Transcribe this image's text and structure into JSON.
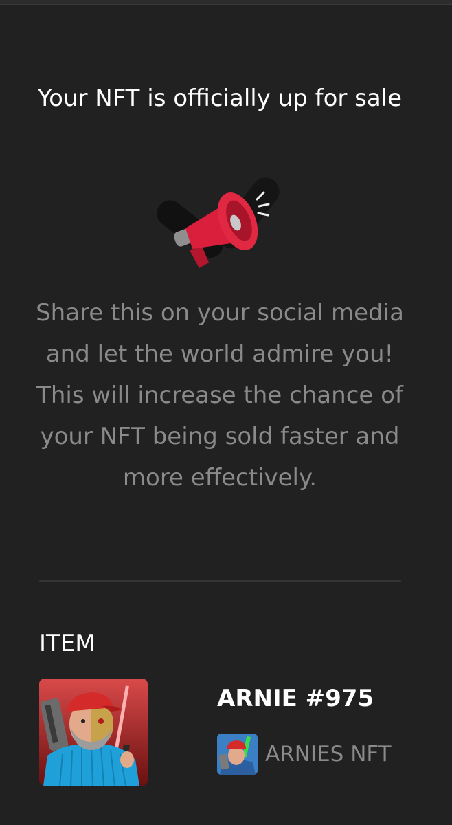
{
  "header": {
    "title": "Your NFT is officially up for sale"
  },
  "illustration": {
    "icon": "megaphone-icon",
    "accent_color": "#d91f3c"
  },
  "message": {
    "text": "Share this on your social media and let the world admire you! This will increase the chance of your NFT being sold faster and more effectively."
  },
  "item": {
    "heading": "ITEM",
    "name": "ARNIE #975",
    "collection_name": "ARNIES NFT",
    "thumbnail_icon": "nft-artwork",
    "collection_icon": "collection-avatar"
  },
  "colors": {
    "background": "#212121",
    "primary_text": "#ffffff",
    "secondary_text": "#8a8a8a",
    "divider": "#333333"
  }
}
